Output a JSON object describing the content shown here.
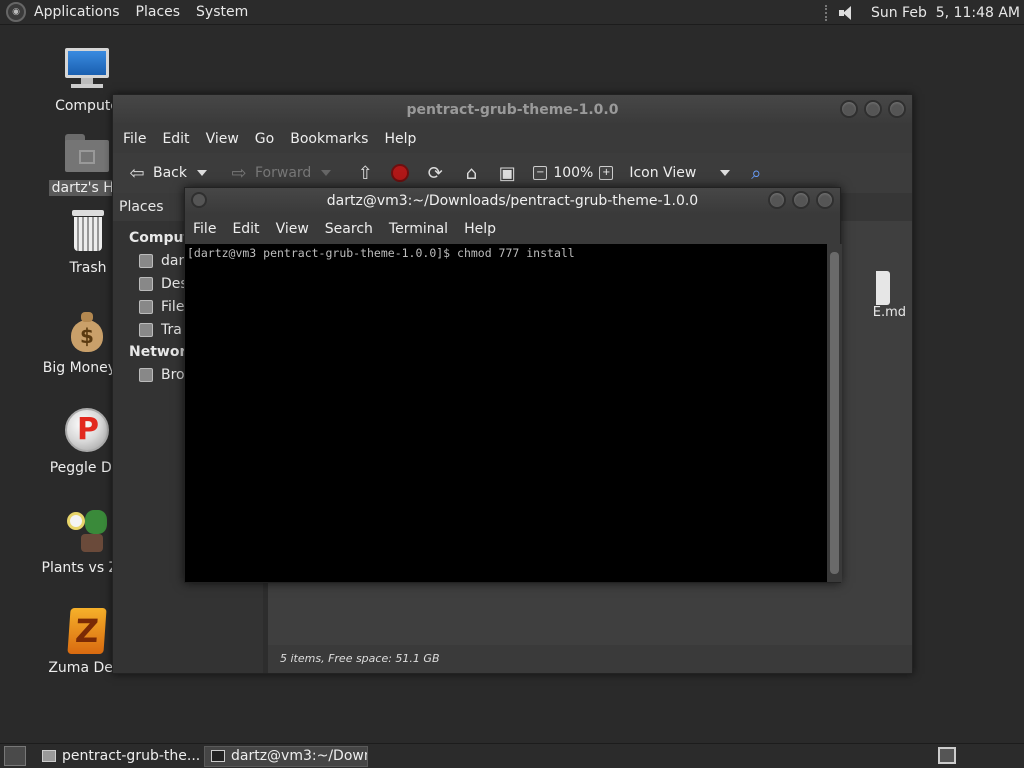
{
  "top_panel": {
    "menus": [
      "Applications",
      "Places",
      "System"
    ],
    "clock": "Sun Feb  5, 11:48 AM"
  },
  "desktop_icons": [
    {
      "label": "Compute",
      "icon": "computer-icon"
    },
    {
      "label": "dartz's Ho",
      "icon": "home-folder-icon"
    },
    {
      "label": "Trash",
      "icon": "trash-icon"
    },
    {
      "label": "Big Money D",
      "icon": "money-bag-icon"
    },
    {
      "label": "Peggle Del",
      "icon": "peggle-icon"
    },
    {
      "label": "Plants vs Zor",
      "icon": "plants-icon"
    },
    {
      "label": "Zuma Delu",
      "icon": "zuma-icon"
    }
  ],
  "file_manager": {
    "title": "pentract-grub-theme-1.0.0",
    "menus": [
      "File",
      "Edit",
      "View",
      "Go",
      "Bookmarks",
      "Help"
    ],
    "toolbar": {
      "back": "Back",
      "forward": "Forward",
      "zoom": "100%",
      "view_mode": "Icon View"
    },
    "places_label": "Places",
    "sidebar": {
      "computer_head": "Compute",
      "computer_items": [
        "dar",
        "Des",
        "File",
        "Tra"
      ],
      "network_head": "Network",
      "network_items": [
        "Bro"
      ]
    },
    "visible_file": "E.md",
    "status": "5 items, Free space: 51.1 GB"
  },
  "terminal": {
    "title": "dartz@vm3:~/Downloads/pentract-grub-theme-1.0.0",
    "menus": [
      "File",
      "Edit",
      "View",
      "Search",
      "Terminal",
      "Help"
    ],
    "line": "[dartz@vm3 pentract-grub-theme-1.0.0]$ chmod 777 install"
  },
  "taskbar": {
    "tasks": [
      "pentract-grub-the...",
      "dartz@vm3:~/Down..."
    ]
  }
}
